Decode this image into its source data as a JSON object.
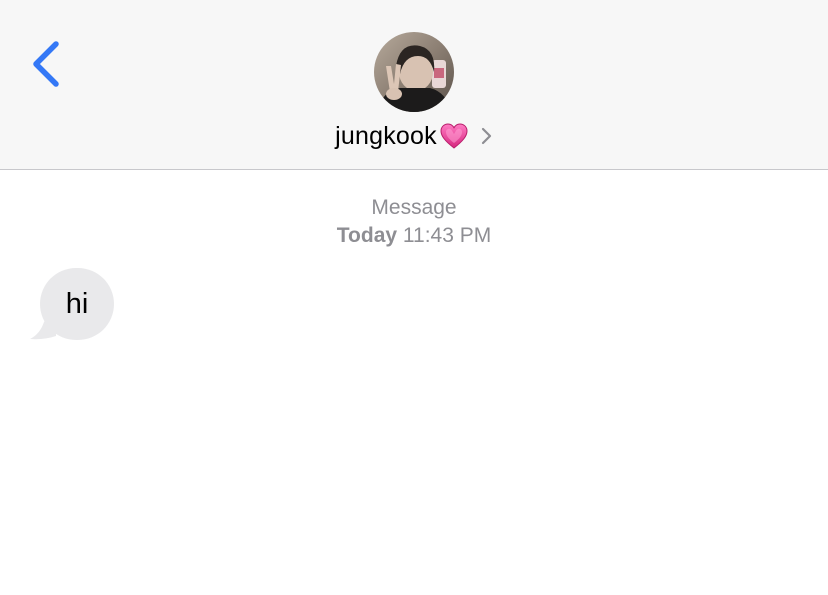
{
  "header": {
    "back_icon": "chevron-left-icon",
    "accent_color": "#3478f6",
    "avatar_alt": "jungkook",
    "contact_name": "jungkook",
    "contact_emoji": "pink-heart-icon",
    "detail_icon": "chevron-right-icon"
  },
  "conversation": {
    "service_label": "Message",
    "time_day": "Today",
    "time_value": "11:43 PM",
    "messages": [
      {
        "direction": "incoming",
        "text": "hi"
      }
    ]
  },
  "colors": {
    "header_bg": "#f7f7f7",
    "incoming_bubble": "#e9e9eb",
    "meta_text": "#8e8e93",
    "heart": "#e9419f"
  }
}
